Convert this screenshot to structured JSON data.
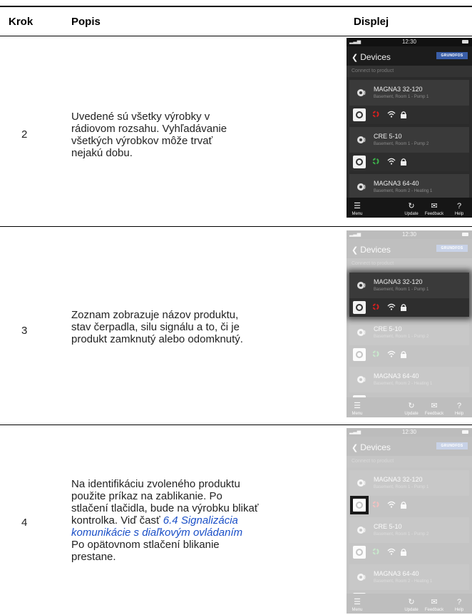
{
  "headers": {
    "step": "Krok",
    "desc": "Popis",
    "display": "Displej"
  },
  "rows": [
    {
      "step": "2",
      "desc_lines": [
        "Uvedené sú všetky výrobky v rádiovom rozsahu. Vyhľadávanie všetkých výrobkov môže trvať nejakú dobu."
      ]
    },
    {
      "step": "3",
      "desc_lines": [
        "Zoznam zobrazuje názov produktu, stav čerpadla, silu signálu a to, či je produkt zamknutý alebo odomknutý."
      ]
    },
    {
      "step": "4",
      "desc_pre": "Na identifikáciu zvoleného produktu použite príkaz na zablikanie. Po stlačení tlačidla, bude na výrobku blikať kontrolka. Viď časť",
      "desc_link": "6.4 Signalizácia komunikácie s diaľkovým ovládaním",
      "desc_post": "Po opätovnom stlačení blikanie prestane."
    }
  ],
  "phone": {
    "time": "12:30",
    "back_label": "Devices",
    "logo": "GRUNDFOS",
    "connect_label": "Connect to product",
    "devices": [
      {
        "name": "MAGNA3 32-120",
        "location": "Basement, Room 1 - Pump 1",
        "state_color": "#d42020"
      },
      {
        "name": "CRE 5-10",
        "location": "Basement, Room 1 - Pump 2",
        "state_color": "#3cb04a"
      },
      {
        "name": "MAGNA3 64-40",
        "location": "Basement, Room 2 - Heating 1",
        "state_color": "#3cb04a"
      }
    ],
    "tabs": {
      "menu": "Menu",
      "update": "Update",
      "feedback": "Feedback",
      "help": "Help"
    },
    "icons": {
      "menu": "list-icon",
      "update": "refresh-icon",
      "feedback": "envelope-icon",
      "help": "question-icon"
    }
  }
}
